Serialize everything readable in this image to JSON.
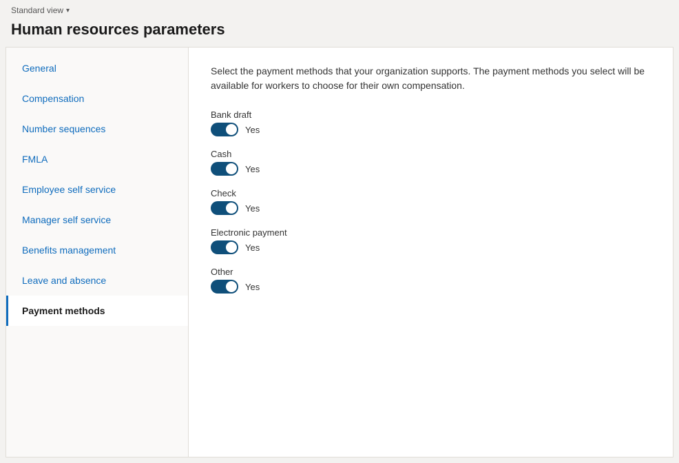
{
  "topBar": {
    "standardView": "Standard view",
    "chevron": "▾"
  },
  "pageTitle": "Human resources parameters",
  "sidebar": {
    "items": [
      {
        "id": "general",
        "label": "General",
        "active": false
      },
      {
        "id": "compensation",
        "label": "Compensation",
        "active": false
      },
      {
        "id": "number-sequences",
        "label": "Number sequences",
        "active": false
      },
      {
        "id": "fmla",
        "label": "FMLA",
        "active": false
      },
      {
        "id": "employee-self-service",
        "label": "Employee self service",
        "active": false
      },
      {
        "id": "manager-self-service",
        "label": "Manager self service",
        "active": false
      },
      {
        "id": "benefits-management",
        "label": "Benefits management",
        "active": false
      },
      {
        "id": "leave-and-absence",
        "label": "Leave and absence",
        "active": false
      },
      {
        "id": "payment-methods",
        "label": "Payment methods",
        "active": true
      }
    ]
  },
  "main": {
    "description": "Select the payment methods that your organization supports. The payment methods you select will be available for workers to choose for their own compensation.",
    "paymentMethods": [
      {
        "id": "bank-draft",
        "label": "Bank draft",
        "enabled": true,
        "valueLabel": "Yes"
      },
      {
        "id": "cash",
        "label": "Cash",
        "enabled": true,
        "valueLabel": "Yes"
      },
      {
        "id": "check",
        "label": "Check",
        "enabled": true,
        "valueLabel": "Yes"
      },
      {
        "id": "electronic-payment",
        "label": "Electronic payment",
        "enabled": true,
        "valueLabel": "Yes"
      },
      {
        "id": "other",
        "label": "Other",
        "enabled": true,
        "valueLabel": "Yes"
      }
    ]
  }
}
